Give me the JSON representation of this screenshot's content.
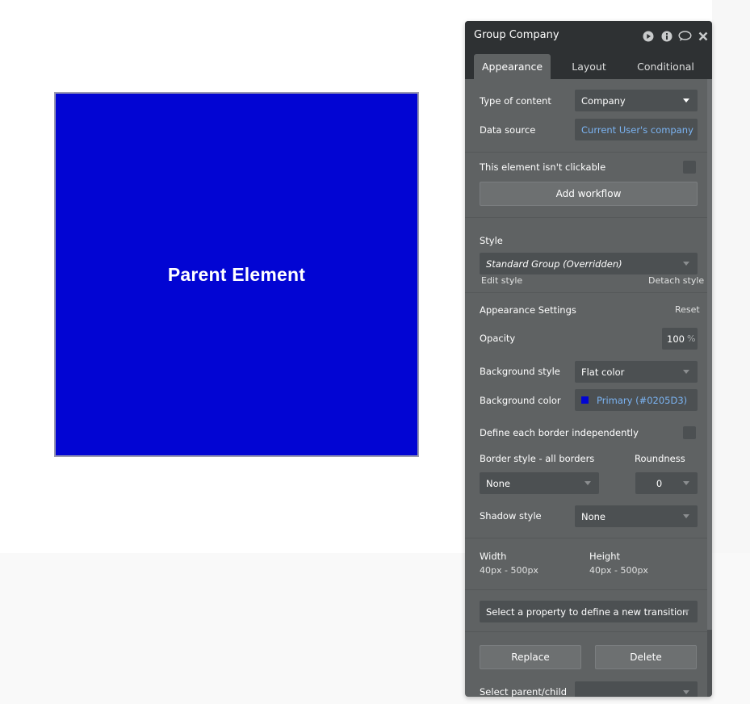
{
  "canvas": {
    "parent_element": {
      "label": "Parent Element",
      "color": "#0205D3"
    }
  },
  "panel": {
    "title": "Group Company",
    "header_icons": [
      "play-icon",
      "info-icon",
      "comment-icon",
      "close-icon"
    ],
    "tabs": [
      {
        "label": "Appearance",
        "active": true
      },
      {
        "label": "Layout",
        "active": false
      },
      {
        "label": "Conditional",
        "active": false
      }
    ],
    "type_of_content": {
      "label": "Type of content",
      "value": "Company"
    },
    "data_source": {
      "label": "Data source",
      "value": "Current User's company"
    },
    "not_clickable": {
      "label": "This element isn't clickable",
      "checked": false
    },
    "add_workflow": "Add workflow",
    "style": {
      "label": "Style",
      "value": "Standard Group (Overridden)",
      "edit_link": "Edit style",
      "detach_link": "Detach style"
    },
    "appearance_settings": {
      "label": "Appearance Settings",
      "reset": "Reset"
    },
    "opacity": {
      "label": "Opacity",
      "value": "100",
      "unit": "%"
    },
    "background_style": {
      "label": "Background style",
      "value": "Flat color"
    },
    "background_color": {
      "label": "Background color",
      "value": "Primary (#0205D3)",
      "swatch": "#0205D3"
    },
    "border_independent": {
      "label": "Define each border independently",
      "checked": false
    },
    "border_style": {
      "label": "Border style - all borders",
      "value": "None"
    },
    "roundness": {
      "label": "Roundness",
      "value": "0"
    },
    "shadow_style": {
      "label": "Shadow style",
      "value": "None"
    },
    "width": {
      "label": "Width",
      "value": "40px - 500px"
    },
    "height": {
      "label": "Height",
      "value": "40px - 500px"
    },
    "transition": {
      "placeholder": "Select a property to define a new transition"
    },
    "replace": "Replace",
    "delete": "Delete",
    "select_parent_child": {
      "label": "Select parent/child",
      "value": ""
    }
  },
  "colors": {
    "panel_bg": "#5f6263",
    "panel_header": "#2e3133",
    "field_bg": "#4c5052",
    "link_blue": "#7bb4f3",
    "primary": "#0205D3"
  }
}
